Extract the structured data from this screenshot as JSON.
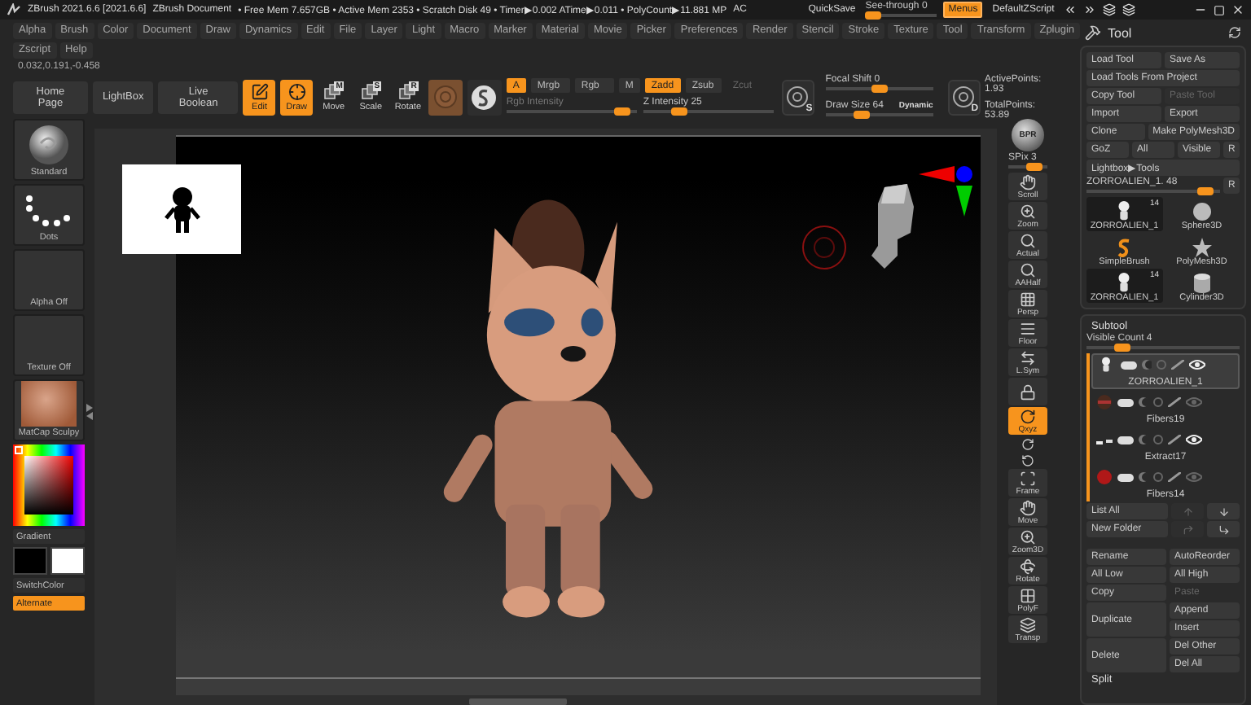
{
  "title_bar": {
    "app": "ZBrush 2021.6.6 [2021.6.6]",
    "document": "ZBrush Document",
    "stats": "• Free Mem 7.657GB • Active Mem 2353 • Scratch Disk 49 • Timer▶0.002 ATime▶0.011 • PolyCount▶11.881 MP",
    "ac": "AC",
    "quicksave": "QuickSave",
    "see_through": {
      "label": "See-through",
      "value": "0",
      "level": 0
    },
    "menus": {
      "label": "Menus",
      "on": true
    },
    "script": "DefaultZScript"
  },
  "menu_rows": [
    [
      "Alpha",
      "Brush",
      "Color",
      "Document",
      "Draw",
      "Dynamics",
      "Edit",
      "File",
      "Layer",
      "Light",
      "Macro",
      "Marker",
      "Material",
      "Movie",
      "Picker",
      "Preferences",
      "Render",
      "Stencil",
      "Stroke",
      "Texture",
      "Tool",
      "Transform",
      "Zplugin"
    ],
    [
      "Zscript",
      "Help"
    ]
  ],
  "coordinates": "0.032,0.191,-0.458",
  "toolbar": {
    "nav": [
      "Home Page",
      "LightBox",
      "Live Boolean"
    ],
    "modes": [
      {
        "kind": "edit",
        "label": "Edit",
        "on": true
      },
      {
        "kind": "draw",
        "label": "Draw",
        "on": true
      },
      {
        "kind": "move",
        "label": "Move",
        "letter": "M",
        "on": false
      },
      {
        "kind": "scale",
        "label": "Scale",
        "letter": "S",
        "on": false
      },
      {
        "kind": "rotate",
        "label": "Rotate",
        "letter": "R",
        "on": false
      }
    ],
    "color_channels": [
      {
        "label": "A",
        "on": true
      },
      {
        "label": "Mrgb",
        "on": false
      },
      {
        "label": "Rgb",
        "on": false
      },
      {
        "label": "M",
        "on": false
      }
    ],
    "depth_modes": [
      {
        "label": "Zadd",
        "on": true,
        "disabled": false
      },
      {
        "label": "Zsub",
        "on": false,
        "disabled": false
      },
      {
        "label": "Zcut",
        "on": false,
        "disabled": true
      }
    ],
    "rgb_intensity": {
      "label": "Rgb Intensity",
      "level": 0.95,
      "disabled": true
    },
    "z_intensity": {
      "label": "Z Intensity",
      "value": "25",
      "level": 0.25,
      "disabled": false
    },
    "stroke_dial": "S",
    "focal_shift": {
      "label": "Focal Shift",
      "value": "0",
      "level": 0.5
    },
    "draw_size": {
      "label": "Draw Size",
      "value": "64",
      "level": 0.3,
      "dynamic": "Dynamic"
    },
    "draw_dial": "D",
    "points": [
      "ActivePoints: 1.93",
      "TotalPoints: 53.89"
    ]
  },
  "left_shelf": {
    "items": [
      {
        "kind": "brush",
        "label": "Standard"
      },
      {
        "kind": "stroke",
        "label": "Dots"
      },
      {
        "kind": "empty",
        "label": "Alpha Off"
      },
      {
        "kind": "empty",
        "label": "Texture Off"
      },
      {
        "kind": "matcap",
        "label": "MatCap Sculpy"
      }
    ],
    "gradient": "Gradient",
    "swatches": [
      {
        "color": "#000000"
      },
      {
        "color": "#ffffff"
      }
    ],
    "switch_color": "SwitchColor",
    "alternate": {
      "label": "Alternate",
      "on": true
    }
  },
  "right_shelf": {
    "bpr": "BPR",
    "spix": {
      "label": "SPix",
      "value": "3",
      "level": 0.75
    },
    "buttons": [
      {
        "kind": "scroll",
        "label": "Scroll",
        "on": false
      },
      {
        "kind": "zoom",
        "label": "Zoom",
        "on": false
      },
      {
        "kind": "actual",
        "label": "Actual",
        "on": false
      },
      {
        "kind": "aahalf",
        "label": "AAHalf",
        "on": false
      },
      {
        "kind": "persp",
        "label": "Persp",
        "on": false
      },
      {
        "kind": "floor",
        "label": "Floor",
        "on": false
      },
      {
        "kind": "lsym",
        "label": "L.Sym",
        "on": false
      },
      {
        "kind": "lock",
        "on": false
      },
      {
        "kind": "qxyz",
        "label": "Qxyz",
        "on": true
      },
      {
        "kind": "qy",
        "on": false
      },
      {
        "kind": "qz",
        "on": false
      },
      {
        "kind": "frame",
        "label": "Frame",
        "on": false
      },
      {
        "kind": "move",
        "label": "Move",
        "on": false
      },
      {
        "kind": "zoom3d",
        "label": "Zoom3D",
        "on": false
      },
      {
        "kind": "rotate",
        "label": "Rotate",
        "on": false
      },
      {
        "kind": "polyf",
        "label": "PolyF",
        "on": false
      },
      {
        "kind": "transp",
        "label": "Transp",
        "on": false
      }
    ]
  },
  "tool_panel": {
    "title": "Tool",
    "button_rows": [
      [
        {
          "label": "Load Tool",
          "disabled": false
        },
        {
          "label": "Save As",
          "disabled": false
        }
      ],
      [
        {
          "label": "Load Tools From Project",
          "disabled": false
        }
      ],
      [
        {
          "label": "Copy Tool",
          "disabled": false
        },
        {
          "label": "Paste Tool",
          "disabled": true
        }
      ],
      [
        {
          "label": "Import",
          "disabled": false
        },
        {
          "label": "Export",
          "disabled": false
        }
      ],
      [
        {
          "label": "Clone",
          "disabled": false
        },
        {
          "label": "Make PolyMesh3D",
          "disabled": false
        }
      ],
      [
        {
          "label": "GoZ",
          "disabled": false
        },
        {
          "label": "All",
          "disabled": false
        },
        {
          "label": "Visible",
          "disabled": false
        },
        {
          "label": "R",
          "disabled": false
        }
      ],
      [
        {
          "label": "Lightbox▶Tools",
          "disabled": false
        }
      ]
    ],
    "tool_slider": {
      "label": "ZORROALIEN_1. 48",
      "level": 0.95,
      "reset": "R"
    },
    "tools": [
      {
        "kind": "figure",
        "label": "ZORROALIEN_1",
        "count": "14"
      },
      {
        "kind": "sphere",
        "label": "Sphere3D"
      },
      {
        "kind": "brush",
        "label": "SimpleBrush"
      },
      {
        "kind": "star",
        "label": "PolyMesh3D"
      },
      {
        "kind": "figure",
        "label": "ZORROALIEN_1",
        "count": "14"
      },
      {
        "kind": "cylinder",
        "label": "Cylinder3D"
      }
    ]
  },
  "subtool": {
    "title": "Subtool",
    "visible_count": {
      "label": "Visible Count",
      "value": "4",
      "level": 0.2
    },
    "items": [
      {
        "kind": "figure",
        "name": "ZORROALIEN_1",
        "selected": true,
        "visible": true
      },
      {
        "kind": "fibers",
        "name": "Fibers19",
        "selected": false,
        "visible": false
      },
      {
        "kind": "strip",
        "name": "Extract17",
        "selected": false,
        "visible": true
      },
      {
        "kind": "ball",
        "name": "Fibers14",
        "selected": false,
        "visible": false
      }
    ],
    "arrange": [
      {
        "label": "List All",
        "icons": [
          {
            "kind": "up",
            "disabled": true
          },
          {
            "kind": "down",
            "disabled": false
          }
        ]
      },
      {
        "label": "New Folder",
        "icons": [
          {
            "kind": "turn_right",
            "disabled": true
          },
          {
            "kind": "turn_down",
            "disabled": false
          }
        ]
      }
    ],
    "actions": [
      {
        "left": {
          "label": "Rename",
          "disabled": false
        },
        "right": [
          {
            "label": "AutoReorder",
            "disabled": false
          }
        ]
      },
      {
        "left": {
          "label": "All Low",
          "disabled": false
        },
        "right": [
          {
            "label": "All High",
            "disabled": false
          }
        ]
      },
      {
        "left": {
          "label": "Copy",
          "disabled": false
        },
        "right": [
          {
            "label": "Paste",
            "disabled": true
          }
        ]
      },
      {
        "left": {
          "label": "Duplicate",
          "disabled": false
        },
        "right": [
          {
            "label": "Append",
            "disabled": false
          },
          {
            "label": "Insert",
            "disabled": false
          }
        ]
      },
      {
        "left": {
          "label": "Delete",
          "disabled": false
        },
        "right": [
          {
            "label": "Del Other",
            "disabled": false
          },
          {
            "label": "Del All",
            "disabled": false
          }
        ]
      }
    ],
    "split": "Split"
  }
}
